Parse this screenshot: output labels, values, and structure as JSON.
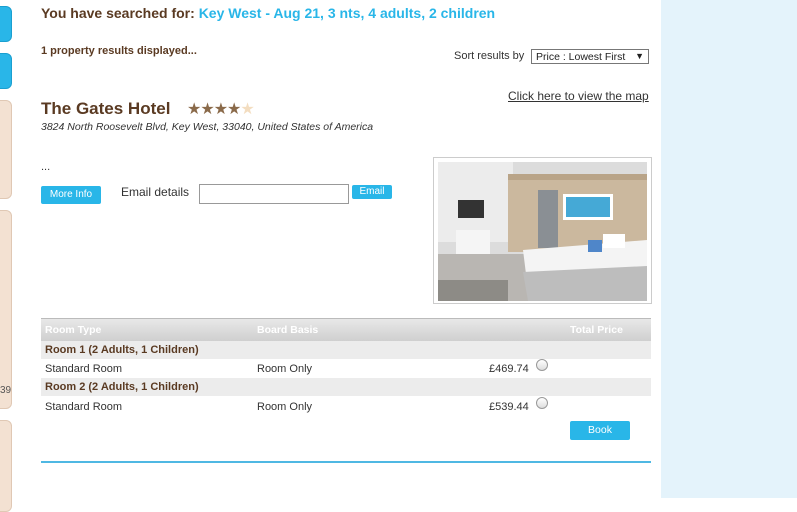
{
  "search": {
    "prefix": "You have searched for:",
    "query": "Key West - Aug 21, 3 nts, 4 adults, 2 children"
  },
  "results": {
    "count_text": "1 property results displayed..."
  },
  "sort": {
    "label": "Sort results by",
    "selected": "Price : Lowest First"
  },
  "hotel": {
    "name": "The Gates Hotel",
    "rating": 4,
    "max_rating": 5,
    "address": "3824 North Roosevelt Blvd, Key West, 33040, United States of America",
    "map_link": "Click here to view the map",
    "description": "...",
    "more_info_label": "More Info",
    "email_label": "Email details",
    "email_value": "",
    "email_button": "Email"
  },
  "table": {
    "headers": {
      "room_type": "Room Type",
      "board_basis": "Board Basis",
      "total_price": "Total Price"
    },
    "rooms": [
      {
        "group": "Room 1 (2 Adults, 1 Children)",
        "type": "Standard Room",
        "board": "Room Only",
        "price": "£469.74"
      },
      {
        "group": "Room 2 (2 Adults, 1 Children)",
        "type": "Standard Room",
        "board": "Room Only",
        "price": "£539.44"
      }
    ],
    "book_label": "Book"
  },
  "sidebar": {
    "partial_number": "39"
  },
  "colors": {
    "accent": "#29b6e8",
    "brown": "#5a3a22",
    "panel": "#e4f3fb"
  }
}
